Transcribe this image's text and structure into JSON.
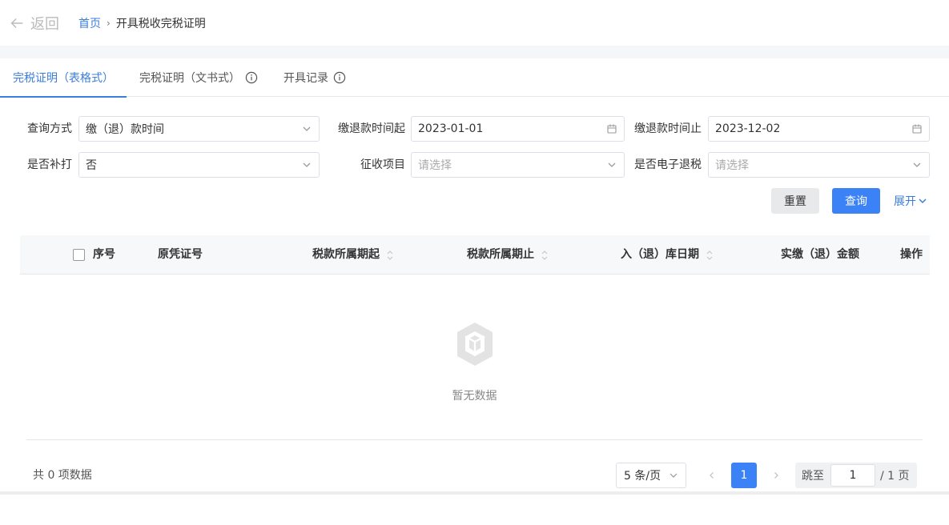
{
  "header": {
    "back_label": "返回",
    "breadcrumb": {
      "home": "首页",
      "separator": "›",
      "current": "开具税收完税证明"
    }
  },
  "tabs": [
    {
      "label": "完税证明（表格式）",
      "active": true
    },
    {
      "label": "完税证明（文书式）",
      "active": false
    },
    {
      "label": "开具记录",
      "active": false
    }
  ],
  "filters": {
    "query_mode": {
      "label": "查询方式",
      "value": "缴（退）款时间"
    },
    "pay_start": {
      "label": "缴退款时间起",
      "value": "2023-01-01"
    },
    "pay_end": {
      "label": "缴退款时间止",
      "value": "2023-12-02"
    },
    "reprint": {
      "label": "是否补打",
      "value": "否"
    },
    "levy_item": {
      "label": "征收项目",
      "placeholder": "请选择"
    },
    "e_refund": {
      "label": "是否电子退税",
      "placeholder": "请选择"
    }
  },
  "actions": {
    "reset": "重置",
    "query": "查询",
    "expand": "展开"
  },
  "table": {
    "columns": {
      "seq": "序号",
      "voucher": "原凭证号",
      "period_start": "税款所属期起",
      "period_end": "税款所属期止",
      "storage_date": "入（退）库日期",
      "amount": "实缴（退）金额",
      "ops": "操作"
    },
    "rows": [],
    "empty_text": "暂无数据"
  },
  "pagination": {
    "total": "共 0 项数据",
    "page_size": "5 条/页",
    "current_page": "1",
    "jump_label": "跳至",
    "jump_value": "1",
    "total_pages": "/ 1 页"
  },
  "colors": {
    "accent": "#3b82f6",
    "link": "#3b7ddd"
  }
}
